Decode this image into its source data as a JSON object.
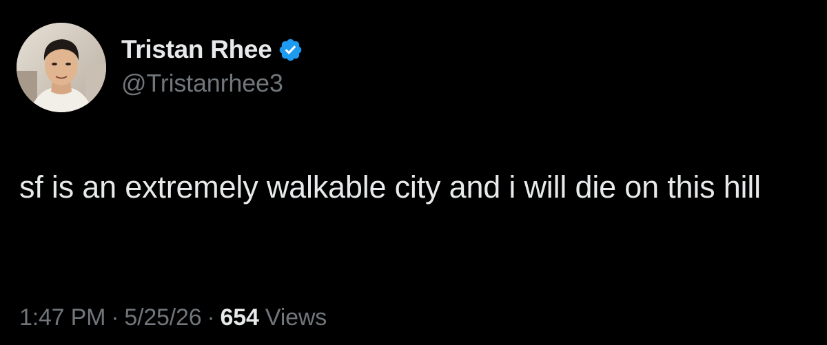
{
  "tweet": {
    "author": {
      "display_name": "Tristan Rhee",
      "handle": "@Tristanrhee3",
      "verified": true,
      "verified_icon": "verified-badge-icon",
      "avatar": "profile-photo"
    },
    "text": "sf is an extremely walkable city and i will die on this hill",
    "meta": {
      "time": "1:47 PM",
      "separator": "·",
      "date": "5/25/26",
      "views_count": "654",
      "views_label": "Views"
    }
  },
  "colors": {
    "background": "#000000",
    "primary_text": "#e7e9ea",
    "secondary_text": "#71767b",
    "verified_blue": "#1d9bf0"
  }
}
